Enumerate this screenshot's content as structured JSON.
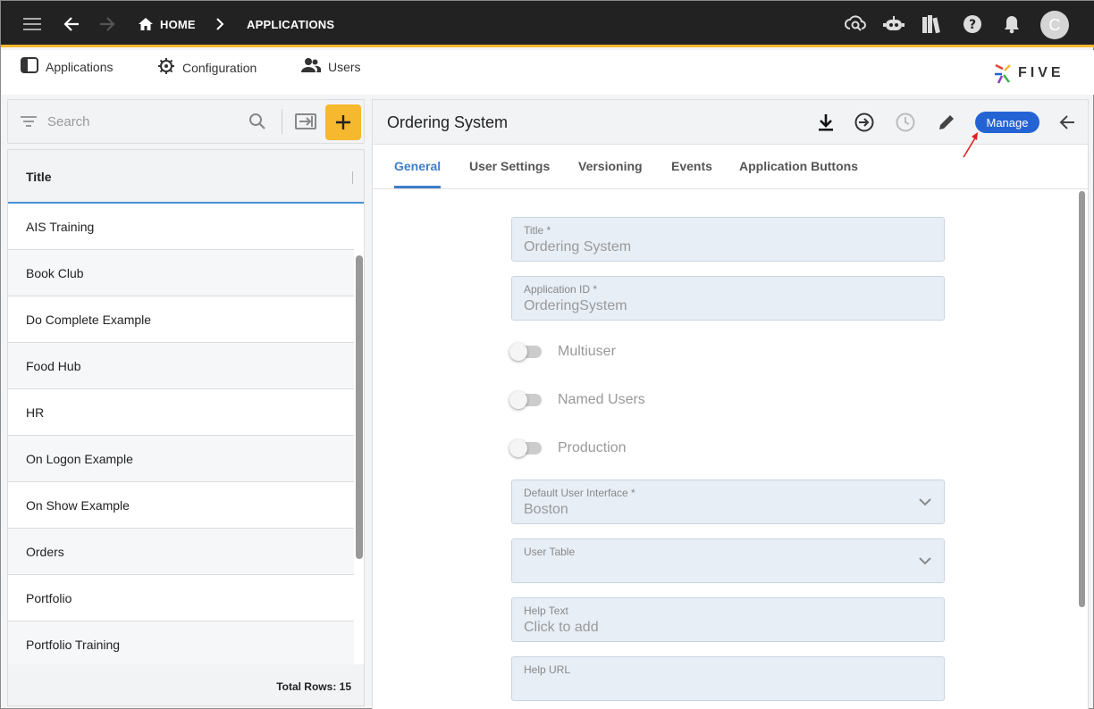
{
  "topbar": {
    "breadcrumb_home": "HOME",
    "breadcrumb_current": "APPLICATIONS",
    "avatar_initial": "C",
    "icons": [
      "menu-icon",
      "back-arrow-icon",
      "forward-arrow-icon",
      "home-icon",
      "chevron-right-icon",
      "cloud-search-icon",
      "robot-icon",
      "books-icon",
      "help-icon",
      "bell-icon"
    ]
  },
  "menu": {
    "items": [
      {
        "label": "Applications",
        "icon": "app-panel-icon"
      },
      {
        "label": "Configuration",
        "icon": "gear-wrench-icon"
      },
      {
        "label": "Users",
        "icon": "users-icon"
      }
    ],
    "logo_text": "FIVE"
  },
  "left": {
    "search_placeholder": "Search",
    "column_title": "Title",
    "rows": [
      "AIS Training",
      "Book Club",
      "Do Complete Example",
      "Food Hub",
      "HR",
      "On Logon Example",
      "On Show Example",
      "Orders",
      "Portfolio",
      "Portfolio Training"
    ],
    "total_rows": "Total Rows: 15"
  },
  "right": {
    "title": "Ordering System",
    "manage_label": "Manage",
    "tabs": [
      "General",
      "User Settings",
      "Versioning",
      "Events",
      "Application Buttons"
    ],
    "fields": {
      "title_label": "Title *",
      "title_value": "Ordering System",
      "appid_label": "Application ID *",
      "appid_value": "OrderingSystem",
      "multiuser": "Multiuser",
      "named_users": "Named Users",
      "production": "Production",
      "ui_label": "Default User Interface *",
      "ui_value": "Boston",
      "user_table_label": "User Table",
      "help_text_label": "Help Text",
      "help_text_value": "Click to add",
      "help_url_label": "Help URL"
    }
  },
  "colors": {
    "topbar_bg": "#222222",
    "accent_yellow": "#f5b82e",
    "manage_blue": "#2463d4",
    "tab_active": "#3f7fc9",
    "annotation_red": "#e02020"
  }
}
